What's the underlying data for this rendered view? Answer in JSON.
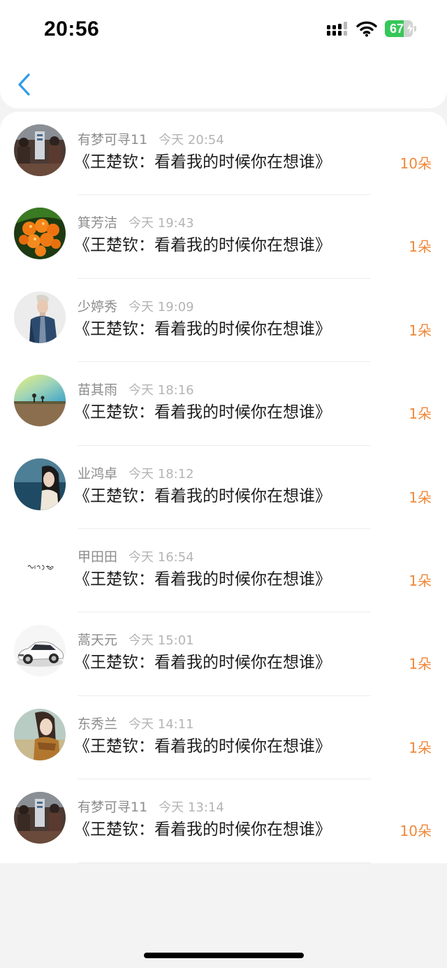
{
  "status_bar": {
    "time": "20:56",
    "battery_level": "67",
    "battery_fraction": 0.67,
    "battery_color": "#36c759",
    "icons": [
      "signal-icon",
      "wifi-icon",
      "battery-icon"
    ]
  },
  "nav": {
    "back_icon": "chevron-left-icon",
    "accent": "#2f9be8"
  },
  "list": {
    "items": [
      {
        "name": "有梦可寻11",
        "time": "今天 20:54",
        "title": "《王楚钦：看着我的时候你在想谁》",
        "count": "10朵",
        "avatar": "people-photo"
      },
      {
        "name": "箕芳洁",
        "time": "今天 19:43",
        "title": "《王楚钦：看着我的时候你在想谁》",
        "count": "1朵",
        "avatar": "fruit-photo"
      },
      {
        "name": "少婷秀",
        "time": "今天 19:09",
        "title": "《王楚钦：看着我的时候你在想谁》",
        "count": "1朵",
        "avatar": "man-photo"
      },
      {
        "name": "苗其雨",
        "time": "今天 18:16",
        "title": "《王楚钦：看着我的时候你在想谁》",
        "count": "1朵",
        "avatar": "field-photo"
      },
      {
        "name": "业鸿卓",
        "time": "今天 18:12",
        "title": "《王楚钦：看着我的时候你在想谁》",
        "count": "1朵",
        "avatar": "girl-sea-photo"
      },
      {
        "name": "甲田田",
        "time": "今天 16:54",
        "title": "《王楚钦：看着我的时候你在想谁》",
        "count": "1朵",
        "avatar": "text-doodle"
      },
      {
        "name": "蒿天元",
        "time": "今天 15:01",
        "title": "《王楚钦：看着我的时候你在想谁》",
        "count": "1朵",
        "avatar": "car-photo"
      },
      {
        "name": "东秀兰",
        "time": "今天 14:11",
        "title": "《王楚钦：看着我的时候你在想谁》",
        "count": "1朵",
        "avatar": "woman-scarf-photo"
      },
      {
        "name": "有梦可寻11",
        "time": "今天 13:14",
        "title": "《王楚钦：看着我的时候你在想谁》",
        "count": "10朵",
        "avatar": "people-photo"
      }
    ],
    "count_color": "#f0883a"
  }
}
